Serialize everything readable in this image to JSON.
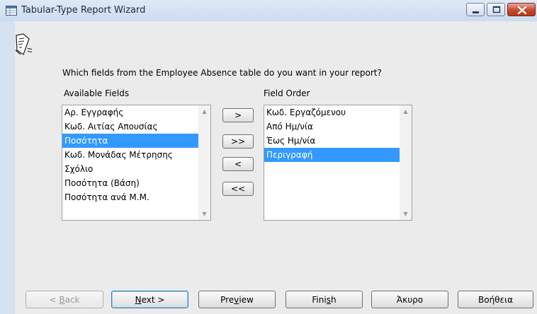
{
  "window": {
    "title": "Tabular-Type Report Wizard",
    "icon": "table-icon",
    "controls": [
      "minimize-icon",
      "maximize-icon",
      "close-icon"
    ]
  },
  "wizard": {
    "question": "Which fields from the Employee Absence table do you want in your report?",
    "icon": "wizard-scroll-icon"
  },
  "available": {
    "label": "Available Fields",
    "items": [
      "Αρ. Εγγραφής",
      "Κωδ. Αιτίας Απουσίας",
      "Ποσότητα",
      "Κωδ. Μονάδας Μέτρησης",
      "Σχόλιο",
      "Ποσότητα (Βάση)",
      "Ποσότητα ανά Μ.Μ."
    ],
    "selected": "Ποσότητα"
  },
  "order": {
    "label": "Field Order",
    "items": [
      "Κωδ. Εργαζόμενου",
      "Από Ημ/νία",
      "Έως Ημ/νία",
      "Περιγραφή"
    ],
    "selected": "Περιγραφή"
  },
  "transfer": {
    "add": ">",
    "add_all": ">>",
    "remove": "<",
    "remove_all": "<<"
  },
  "footer": {
    "back": {
      "pre": "< ",
      "key": "B",
      "post": "ack"
    },
    "next": {
      "key": "N",
      "post": "ext >"
    },
    "preview": {
      "pre": "Pre",
      "key": "v",
      "post": "iew"
    },
    "finish": {
      "pre": "Fini",
      "key": "s",
      "post": "h"
    },
    "cancel": "Άκυρο",
    "help": "Βοήθεια"
  },
  "colors": {
    "selection": "#3399ff",
    "title_bar": "#cbdcf0",
    "client_bg": "#ebebeb",
    "close_button": "#c7462c"
  }
}
